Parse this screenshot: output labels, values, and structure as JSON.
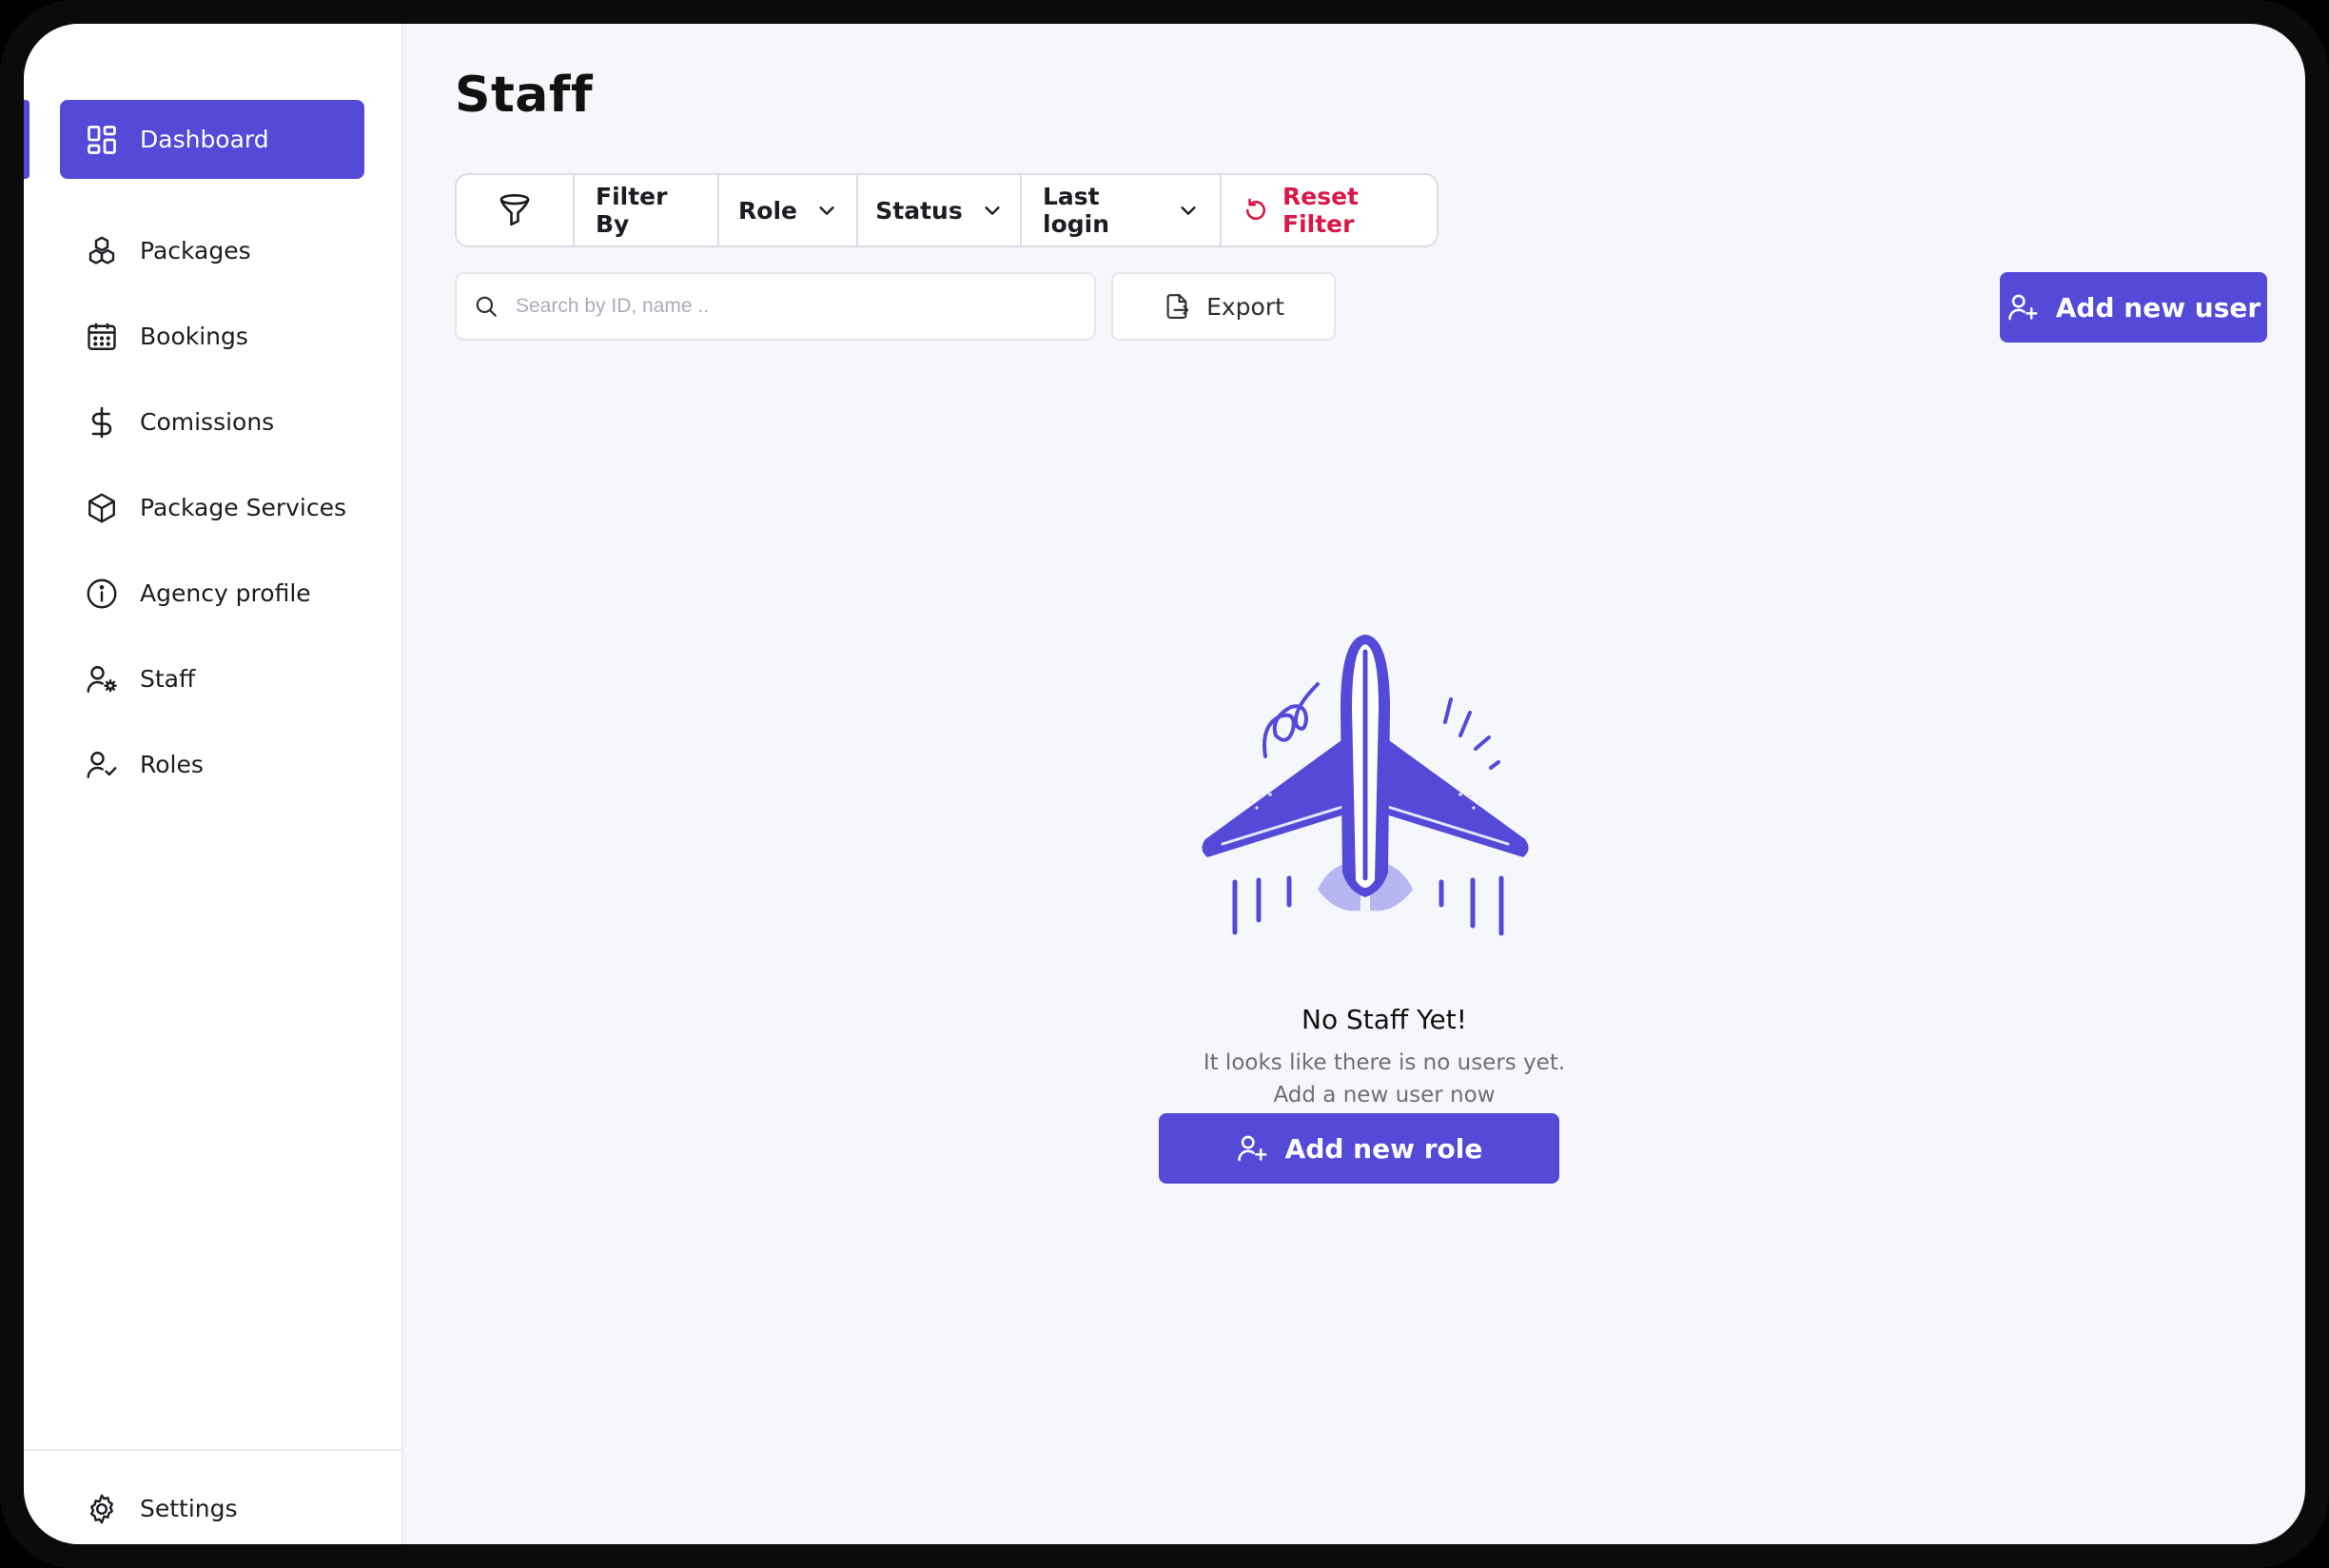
{
  "page": {
    "title": "Staff"
  },
  "sidebar": {
    "items": [
      {
        "label": "Dashboard",
        "icon": "dashboard-icon",
        "active": true
      },
      {
        "label": "Packages",
        "icon": "cubes-icon"
      },
      {
        "label": "Bookings",
        "icon": "calendar-icon"
      },
      {
        "label": "Comissions",
        "icon": "dollar-icon"
      },
      {
        "label": "Package Services",
        "icon": "box-icon"
      },
      {
        "label": "Agency profile",
        "icon": "info-icon"
      },
      {
        "label": "Staff",
        "icon": "user-gear-icon"
      },
      {
        "label": "Roles",
        "icon": "user-check-icon"
      }
    ],
    "settings": {
      "label": "Settings",
      "icon": "gear-icon"
    }
  },
  "filters": {
    "filter_by": "Filter By",
    "role": "Role",
    "status": "Status",
    "last_login": "Last login",
    "reset": "Reset Filter"
  },
  "search": {
    "placeholder": "Search by ID, name .."
  },
  "toolbar": {
    "export_label": "Export",
    "add_user_label": "Add new user"
  },
  "empty_state": {
    "title": "No Staff Yet!",
    "line1": "It looks like there is no users yet.",
    "line2": "Add a new user now",
    "button_label": "Add new role"
  },
  "colors": {
    "accent": "#5549d8",
    "danger": "#d8184a",
    "background": "#f6f7fb"
  }
}
